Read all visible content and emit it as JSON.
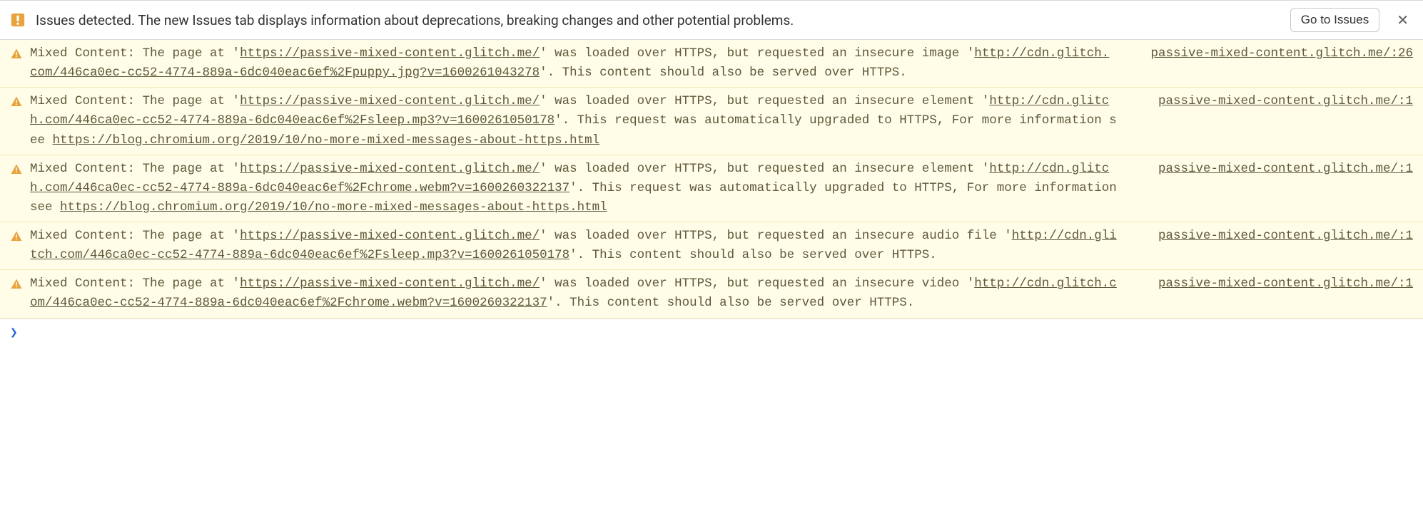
{
  "issues_bar": {
    "text": "Issues detected. The new Issues tab displays information about deprecations, breaking changes and other potential problems.",
    "button_label": "Go to Issues",
    "close_glyph": "✕"
  },
  "page_url": "https://passive-mixed-content.glitch.me/",
  "warnings": [
    {
      "source": "passive-mixed-content.glitch.me/:26",
      "pre": "Mixed Content: The page at '",
      "page_url": "https://passive-mixed-content.glitch.me/",
      "mid1": "' was loaded over HTTPS, but requested an insecure image '",
      "res_url": "http://cdn.glitch.com/446ca0ec-cc52-4774-889a-6dc040eac6ef%2Fpuppy.jpg?v=1600261043278",
      "tail": "'. This content should also be served over HTTPS.",
      "extra_link": ""
    },
    {
      "source": "passive-mixed-content.glitch.me/:1",
      "pre": "Mixed Content: The page at '",
      "page_url": "https://passive-mixed-content.glitch.me/",
      "mid1": "' was loaded over HTTPS, but requested an insecure element '",
      "res_url": "http://cdn.glitch.com/446ca0ec-cc52-4774-889a-6dc040eac6ef%2Fsleep.mp3?v=1600261050178",
      "tail": "'. This request was automatically upgraded to HTTPS, For more information see ",
      "extra_link": "https://blog.chromium.org/2019/10/no-more-mixed-messages-about-https.html"
    },
    {
      "source": "passive-mixed-content.glitch.me/:1",
      "pre": "Mixed Content: The page at '",
      "page_url": "https://passive-mixed-content.glitch.me/",
      "mid1": "' was loaded over HTTPS, but requested an insecure element '",
      "res_url": "http://cdn.glitch.com/446ca0ec-cc52-4774-889a-6dc040eac6ef%2Fchrome.webm?v=1600260322137",
      "tail": "'. This request was automatically upgraded to HTTPS, For more information see ",
      "extra_link": "https://blog.chromium.org/2019/10/no-more-mixed-messages-about-https.html"
    },
    {
      "source": "passive-mixed-content.glitch.me/:1",
      "pre": "Mixed Content: The page at '",
      "page_url": "https://passive-mixed-content.glitch.me/",
      "mid1": "' was loaded over HTTPS, but requested an insecure audio file '",
      "res_url": "http://cdn.glitch.com/446ca0ec-cc52-4774-889a-6dc040eac6ef%2Fsleep.mp3?v=1600261050178",
      "tail": "'. This content should also be served over HTTPS.",
      "extra_link": ""
    },
    {
      "source": "passive-mixed-content.glitch.me/:1",
      "pre": "Mixed Content: The page at '",
      "page_url": "https://passive-mixed-content.glitch.me/",
      "mid1": "' was loaded over HTTPS, but requested an insecure video '",
      "res_url": "http://cdn.glitch.com/446ca0ec-cc52-4774-889a-6dc040eac6ef%2Fchrome.webm?v=1600260322137",
      "tail": "'. This content should also be served over HTTPS.",
      "extra_link": ""
    }
  ],
  "prompt_glyph": "❯"
}
